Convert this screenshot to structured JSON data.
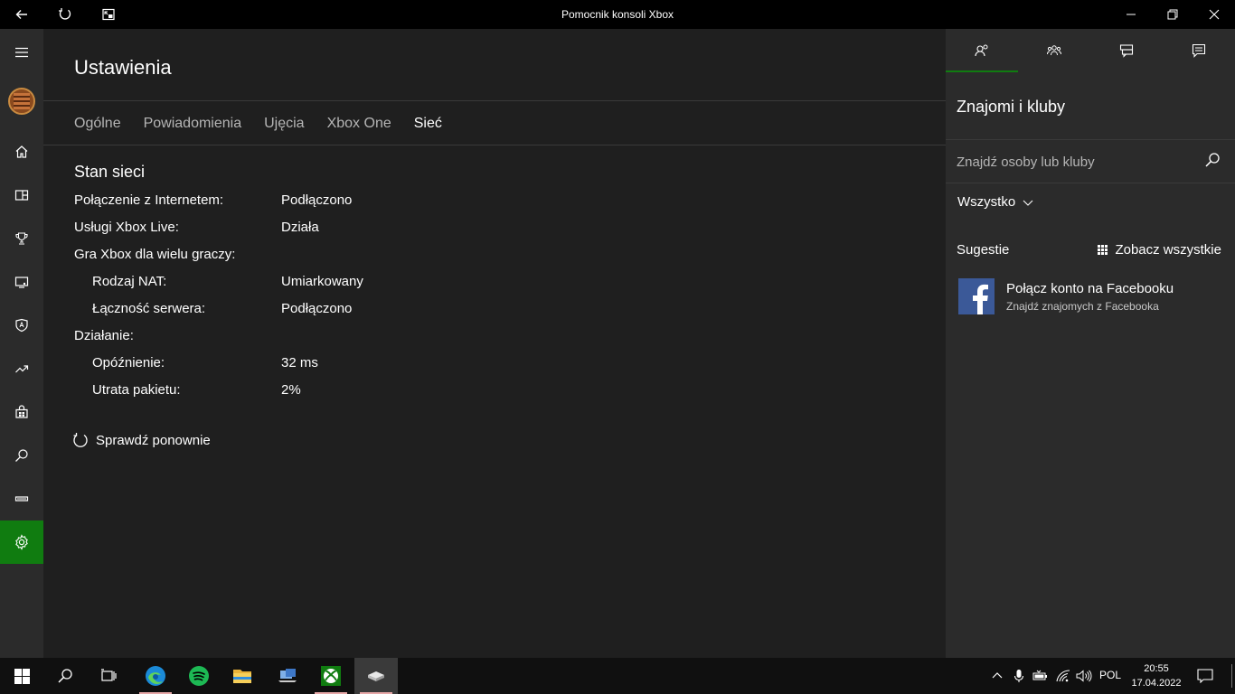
{
  "window": {
    "title": "Pomocnik konsoli Xbox"
  },
  "main": {
    "page_title": "Ustawienia",
    "tabs": [
      {
        "label": "Ogólne"
      },
      {
        "label": "Powiadomienia"
      },
      {
        "label": "Ujęcia"
      },
      {
        "label": "Xbox One"
      },
      {
        "label": "Sieć",
        "active": true
      }
    ],
    "network": {
      "section_title": "Stan sieci",
      "rows": [
        {
          "label": "Połączenie z Internetem:",
          "value": "Podłączono",
          "indent": false
        },
        {
          "label": "Usługi Xbox Live:",
          "value": "Działa",
          "indent": false
        },
        {
          "label": "Gra Xbox dla wielu graczy:",
          "value": "",
          "indent": false
        },
        {
          "label": "Rodzaj NAT:",
          "value": "Umiarkowany",
          "indent": true
        },
        {
          "label": "Łączność serwera:",
          "value": "Podłączono",
          "indent": true
        },
        {
          "label": "Działanie:",
          "value": "",
          "indent": false
        },
        {
          "label": "Opóźnienie:",
          "value": "32 ms",
          "indent": true
        },
        {
          "label": "Utrata pakietu:",
          "value": "2%",
          "indent": true
        }
      ],
      "retry_label": "Sprawdź ponownie"
    }
  },
  "right_panel": {
    "title": "Znajomi i kluby",
    "search_placeholder": "Znajdź osoby lub kluby",
    "filter_label": "Wszystko",
    "suggestions_label": "Sugestie",
    "see_all_label": "Zobacz wszystkie",
    "facebook": {
      "title": "Połącz konto na Facebooku",
      "subtitle": "Znajdź znajomych z Facebooka"
    }
  },
  "taskbar": {
    "language": "POL",
    "time": "20:55",
    "date": "17.04.2022"
  },
  "colors": {
    "accent": "#107c10",
    "background": "#1f1f1f",
    "panel": "#2b2b2b",
    "facebook": "#3b5998"
  }
}
